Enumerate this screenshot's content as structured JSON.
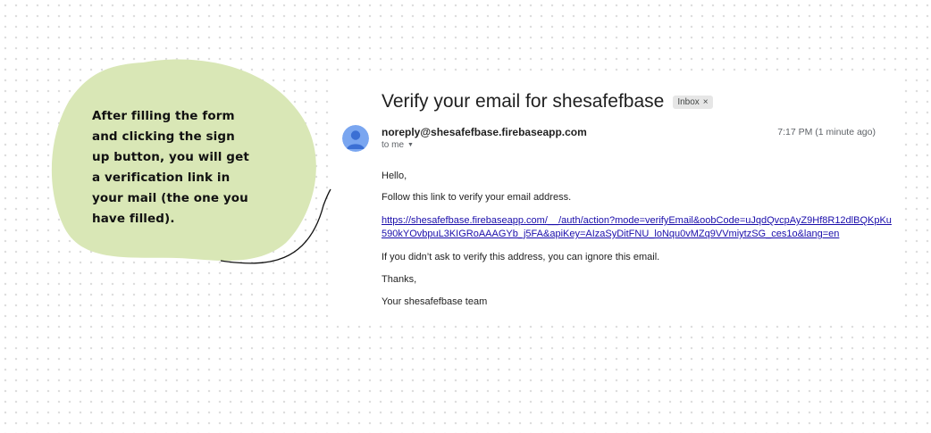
{
  "callout": {
    "text": "After filling the form and clicking the sign up button, you will get a verification link in your mail (the one you have filled).",
    "blob_color": "#d9e7b6"
  },
  "email": {
    "subject": "Verify your email for shesafefbase",
    "badge_label": "Inbox",
    "badge_close": "×",
    "sender": "noreply@shesafefbase.firebaseapp.com",
    "recipient": "to me",
    "timestamp": "7:17 PM (1 minute ago)",
    "greeting": "Hello,",
    "instruction": "Follow this link to verify your email address.",
    "link": "https://shesafefbase.firebaseapp.com/__/auth/action?mode=verifyEmail&oobCode=uJqdQvcpAyZ9Hf8R12dlBQKpKu590kYOvbpuL3KIGRoAAAGYb_j5FA&apiKey=AIzaSyDitFNU_loNqu0vMZq9VVmiytzSG_ces1o&lang=en",
    "ignore_notice": "If you didn’t ask to verify this address, you can ignore this email.",
    "thanks": "Thanks,",
    "signoff": "Your shesafefbase team"
  },
  "colors": {
    "link": "#1a0dab",
    "avatar": "#7aa6f0"
  }
}
